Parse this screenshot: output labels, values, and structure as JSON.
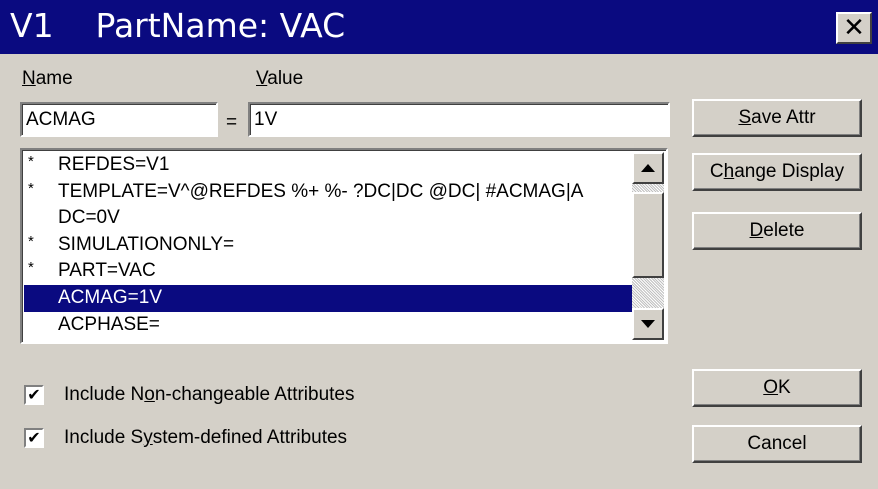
{
  "window": {
    "title": "V1    PartName: VAC",
    "close_glyph": "✕"
  },
  "fields": {
    "name_label_mn": "N",
    "name_label_rest": "ame",
    "value_label_mn": "V",
    "value_label_rest": "alue",
    "name_value": "ACMAG",
    "equals": "=",
    "value_value": "1V"
  },
  "list": {
    "items": [
      {
        "mark": "*",
        "text": "REFDES=V1"
      },
      {
        "mark": "*",
        "text": "TEMPLATE=V^@REFDES %+ %- ?DC|DC @DC| #ACMAG|A"
      },
      {
        "mark": "",
        "text": "DC=0V"
      },
      {
        "mark": "*",
        "text": "SIMULATIONONLY="
      },
      {
        "mark": "*",
        "text": "PART=VAC"
      },
      {
        "mark": "",
        "text": "ACMAG=1V"
      },
      {
        "mark": "",
        "text": "ACPHASE="
      }
    ],
    "selected_index": 5
  },
  "buttons": {
    "save_attr_mn": "S",
    "save_attr_rest": "ave Attr",
    "change_display_pre": "C",
    "change_display_mn": "h",
    "change_display_rest": "ange Display",
    "delete_mn": "D",
    "delete_rest": "elete",
    "ok_mn": "O",
    "ok_rest": "K",
    "cancel": "Cancel"
  },
  "checkboxes": {
    "non_changeable_pre": "Include N",
    "non_changeable_mn": "o",
    "non_changeable_rest": "n-changeable Attributes",
    "non_changeable_checked": true,
    "system_defined_pre": "Include S",
    "system_defined_mn": "y",
    "system_defined_rest": "stem-defined Attributes",
    "system_defined_checked": true,
    "check_glyph": "✔"
  },
  "colors": {
    "titlebar": "#0a0a80",
    "face": "#d4d0c8",
    "selection": "#0a0a80"
  }
}
